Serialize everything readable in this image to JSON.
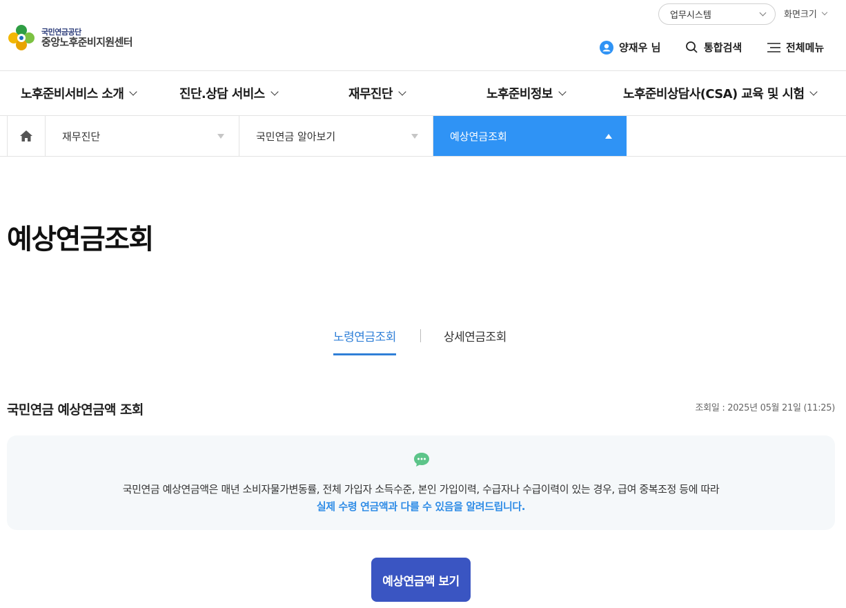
{
  "header": {
    "logo_top": "국민연금공단",
    "logo_bottom": "중앙노후준비지원센터",
    "business_select": "업무시스템",
    "screen_size": "화면크기",
    "user_name": "양재우 님",
    "search_label": "통합검색",
    "all_menu_label": "전체메뉴"
  },
  "gnb": {
    "items": [
      {
        "label": "노후준비서비스 소개"
      },
      {
        "label": "진단.상담 서비스"
      },
      {
        "label": "재무진단"
      },
      {
        "label": "노후준비정보"
      },
      {
        "label": "노후준비상담사(CSA) 교육 및 시험"
      }
    ]
  },
  "breadcrumb": {
    "items": [
      {
        "label": "재무진단"
      },
      {
        "label": "국민연금 알아보기"
      },
      {
        "label": "예상연금조회"
      }
    ]
  },
  "page": {
    "title": "예상연금조회"
  },
  "tabs": [
    {
      "label": "노령연금조회",
      "active": true
    },
    {
      "label": "상세연금조회",
      "active": false
    }
  ],
  "section": {
    "title": "국민연금 예상연금액 조회",
    "date": "조회일 : 2025년 05월 21일 (11:25)"
  },
  "notice": {
    "line1": "국민연금 예상연금액은 매년 소비자물가변동률, 전체 가입자 소득수준, 본인 가입이력, 수급자나 수급이력이 있는 경우, 급여 중복조정 등에 따라",
    "line2": "실제 수령 연금액과 다를 수 있음을 알려드립니다."
  },
  "action": {
    "view_button": "예상연금액 보기"
  },
  "colors": {
    "accent_blue": "#2f93f5",
    "button": "#3a55c2",
    "tab_active": "#2f7fd7",
    "notice_bg": "#f5f8fa"
  }
}
